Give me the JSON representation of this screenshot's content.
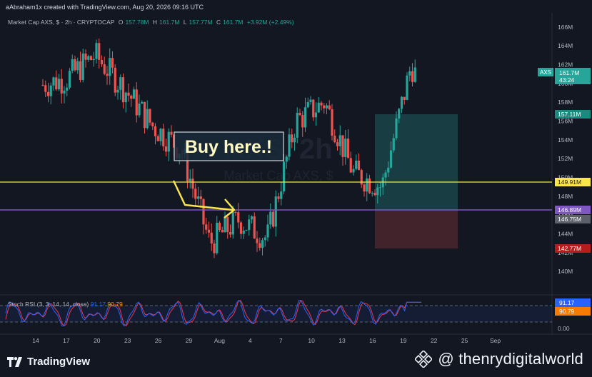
{
  "header": {
    "created_by": "aAbraham1x created with TradingView.com, Aug 20, 2026 09:16 UTC"
  },
  "legend": {
    "symbol": "Market Cap AXS, $ · 2h · CRYPTOCAP",
    "o_label": "O",
    "o_value": "157.78M",
    "h_label": "H",
    "h_value": "161.7M",
    "l_label": "L",
    "l_value": "157.77M",
    "c_label": "C",
    "c_value": "161.7M",
    "change": "+3.92M (+2.49%)"
  },
  "watermark": {
    "line1": "AXS, 2h",
    "line2": "Market Cap AXS, $"
  },
  "annotation": {
    "text": "Buy here.!"
  },
  "price_axis": {
    "ticks": [
      "166M",
      "164M",
      "162M",
      "160M",
      "158M",
      "156M",
      "154M",
      "152M",
      "150M",
      "148M",
      "146M",
      "144M",
      "142M",
      "140M"
    ]
  },
  "price_labels": {
    "symbol_tag": "AXS",
    "last_price": "161.7M",
    "countdown": "43:24",
    "target": "157.11M",
    "yellow_line": "149.91M",
    "purple_line": "146.89M",
    "entry": "146.75M",
    "stop": "142.77M"
  },
  "rsi": {
    "name": "Stoch RSI (3, 3, 14, 14, close)",
    "k_value": "91.17",
    "d_value": "90.79",
    "axis_ticks": [
      "100.00",
      "0.00"
    ],
    "value_labels": [
      "91.17",
      "90.79"
    ]
  },
  "time_axis": {
    "ticks": [
      "14",
      "17",
      "20",
      "23",
      "26",
      "29",
      "Aug",
      "4",
      "7",
      "10",
      "13",
      "16",
      "19",
      "22",
      "25",
      "Sep"
    ]
  },
  "footer": {
    "tv_name": "TradingView",
    "handle": "@ thenrydigitalworld"
  },
  "colors": {
    "up": "#26a69a",
    "down": "#ef5350",
    "yellow": "#fbe74d",
    "purple": "#7e57c2",
    "background": "#131722",
    "rsi_k": "#2962ff",
    "rsi_d": "#f23645"
  },
  "chart_data": {
    "type": "candlestick",
    "x": [
      "Jul 14",
      "Jul 17",
      "Jul 20",
      "Jul 23",
      "Jul 26",
      "Jul 29",
      "Aug 1",
      "Aug 4",
      "Aug 7",
      "Aug 10",
      "Aug 13",
      "Aug 16",
      "Aug 19"
    ],
    "approx_close": [
      160.5,
      163.0,
      159.5,
      155.5,
      153.0,
      143.0,
      145.5,
      143.5,
      156.0,
      158.0,
      150.5,
      149.0,
      161.7
    ],
    "ylim": [
      138.5,
      167.5
    ],
    "last_close": 161.7,
    "horizontal_lines": [
      {
        "value": 149.91,
        "color": "#fbe74d"
      },
      {
        "value": 146.89,
        "color": "#7e57c2"
      }
    ],
    "position": {
      "type": "long",
      "entry": 146.75,
      "target": 157.11,
      "stop": 142.77
    },
    "indicator": {
      "name": "Stoch RSI (3, 3, 14, 14, close)",
      "k": 91.17,
      "d": 90.79,
      "ylim": [
        0,
        100
      ]
    }
  }
}
